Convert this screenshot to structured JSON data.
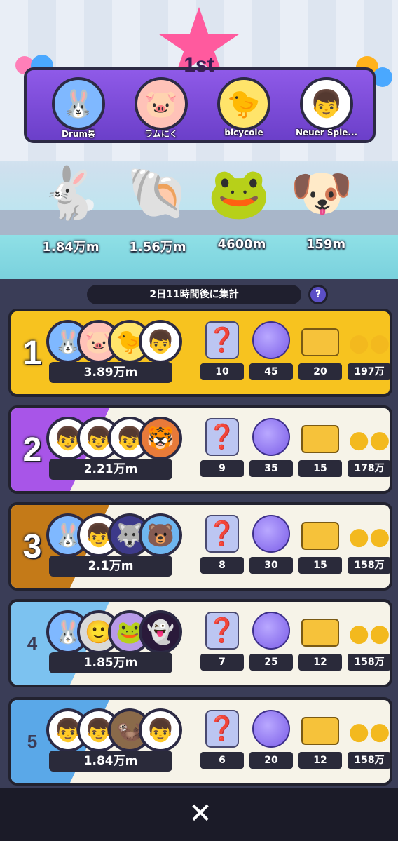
{
  "podium": {
    "title": "1st",
    "players": [
      {
        "name": "Drum통",
        "distance": "1.84万m",
        "avatar_icon": "rabbit-fish-avatar",
        "pet_icon": "blue-rabbit-pet"
      },
      {
        "name": "ラムにく",
        "distance": "1.56万m",
        "avatar_icon": "pig-avatar",
        "pet_icon": "hermit-crab-pet"
      },
      {
        "name": "bicycole",
        "distance": "4600m",
        "avatar_icon": "bird-avatar",
        "pet_icon": "frog-pet"
      },
      {
        "name": "Neuer Spie...",
        "distance": "159m",
        "avatar_icon": "boy-cap-avatar",
        "pet_icon": "blue-dog-pet"
      }
    ]
  },
  "timer": {
    "label": "2日11時間後に集計",
    "help": "?"
  },
  "ranks": [
    {
      "rank": "1",
      "score": "3.89万m",
      "rewards": [
        "10",
        "45",
        "20",
        "197万"
      ],
      "color": "#f7c31f"
    },
    {
      "rank": "2",
      "score": "2.21万m",
      "rewards": [
        "9",
        "35",
        "15",
        "178万"
      ],
      "color": "#a855e8"
    },
    {
      "rank": "3",
      "score": "2.1万m",
      "rewards": [
        "8",
        "30",
        "15",
        "158万"
      ],
      "color": "#c47a18"
    },
    {
      "rank": "4",
      "score": "1.85万m",
      "rewards": [
        "7",
        "25",
        "12",
        "158万"
      ],
      "color": "#7cc2f0"
    },
    {
      "rank": "5",
      "score": "1.84万m",
      "rewards": [
        "6",
        "20",
        "12",
        "158万"
      ],
      "color": "#5aa8e8"
    }
  ],
  "reward_icons": [
    "mystery-box-icon",
    "purple-orb-icon",
    "gold-ticket-icon",
    "coin-pile-icon"
  ],
  "close": {
    "label": "✕"
  }
}
